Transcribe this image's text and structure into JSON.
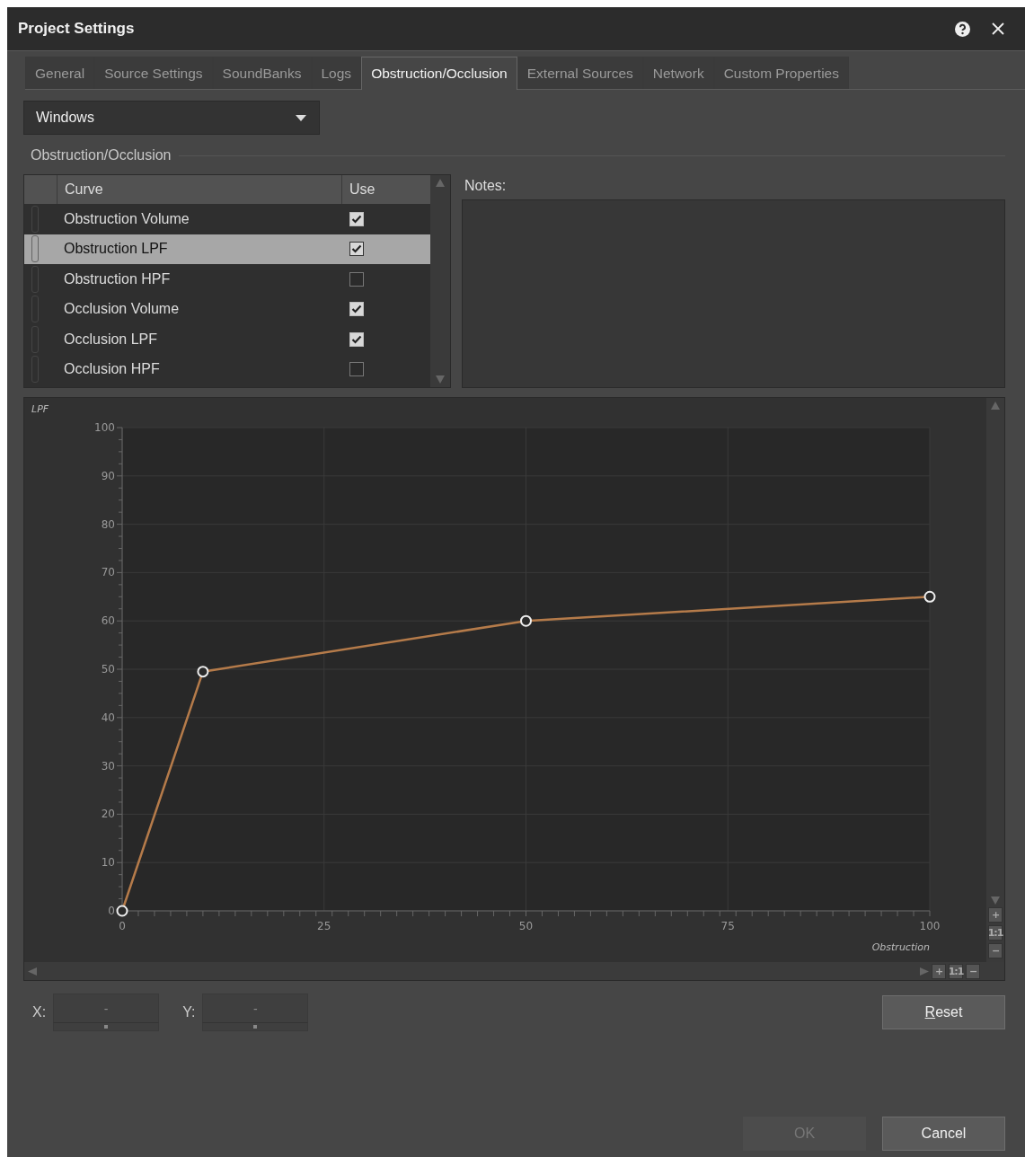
{
  "window": {
    "title": "Project Settings"
  },
  "tabs": [
    {
      "label": "General",
      "selected": false
    },
    {
      "label": "Source Settings",
      "selected": false
    },
    {
      "label": "SoundBanks",
      "selected": false
    },
    {
      "label": "Logs",
      "selected": false
    },
    {
      "label": "Obstruction/Occlusion",
      "selected": true
    },
    {
      "label": "External Sources",
      "selected": false
    },
    {
      "label": "Network",
      "selected": false
    },
    {
      "label": "Custom Properties",
      "selected": false
    }
  ],
  "platform_dropdown": {
    "value": "Windows"
  },
  "group": {
    "title": "Obstruction/Occlusion"
  },
  "curve_table": {
    "columns": [
      "Curve",
      "Use"
    ],
    "rows": [
      {
        "curve": "Obstruction Volume",
        "use": true,
        "selected": false
      },
      {
        "curve": "Obstruction LPF",
        "use": true,
        "selected": true
      },
      {
        "curve": "Obstruction HPF",
        "use": false,
        "selected": false
      },
      {
        "curve": "Occlusion Volume",
        "use": true,
        "selected": false
      },
      {
        "curve": "Occlusion LPF",
        "use": true,
        "selected": false
      },
      {
        "curve": "Occlusion HPF",
        "use": false,
        "selected": false
      }
    ]
  },
  "notes": {
    "label": "Notes:"
  },
  "graph": {
    "chart_data": {
      "type": "line",
      "xlabel": "Obstruction",
      "ylabel": "LPF",
      "x": [
        0,
        10,
        50,
        100
      ],
      "grid": true,
      "series": [
        {
          "color": "#b57b4a",
          "marker": "circle",
          "values": [
            0,
            49.5,
            60,
            65
          ]
        }
      ],
      "xlim": [
        0,
        100
      ],
      "ylim": [
        0,
        100
      ],
      "xticks": [
        0,
        25,
        50,
        75,
        100
      ],
      "yticks": [
        0,
        10,
        20,
        30,
        40,
        50,
        60,
        70,
        80,
        90,
        100
      ]
    },
    "vertical_zoom": [
      "+",
      "1:1",
      "−"
    ],
    "horizontal_zoom": [
      "+",
      "1:1",
      "−"
    ]
  },
  "coordinates": [
    {
      "label": "X:",
      "placeholder": "-"
    },
    {
      "label": "Y:",
      "placeholder": "-"
    }
  ],
  "reset_button": "Reset",
  "buttons": [
    {
      "label": "OK",
      "disabled": true
    },
    {
      "label": "Cancel",
      "disabled": false
    }
  ]
}
